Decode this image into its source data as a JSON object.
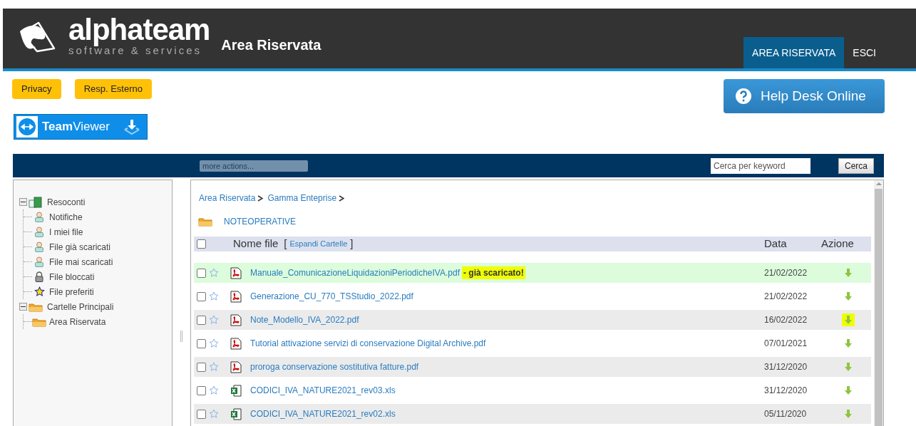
{
  "header": {
    "brand": "alphateam",
    "tagline": "software & services",
    "title": "Area Riservata",
    "nav": [
      {
        "label": "AREA RISERVATA",
        "selected": true
      },
      {
        "label": "ESCI",
        "selected": false
      }
    ]
  },
  "buttons": [
    "Privacy",
    "Resp. Esterno"
  ],
  "teamviewer": {
    "bold": "Team",
    "rest": "Viewer"
  },
  "helpdesk": "Help Desk Online",
  "toolbar": {
    "actions": "more actions...",
    "search_placeholder": "Cerca per keyword",
    "search_button": "Cerca"
  },
  "tree": [
    {
      "label": "Resoconti",
      "kind": "group",
      "expanded": true,
      "children": [
        {
          "label": "Notifiche",
          "kind": "person"
        },
        {
          "label": "I miei file",
          "kind": "person"
        },
        {
          "label": "File già scaricati",
          "kind": "person"
        },
        {
          "label": "File mai scaricati",
          "kind": "person"
        },
        {
          "label": "File bloccati",
          "kind": "lock"
        },
        {
          "label": "File preferiti",
          "kind": "star"
        }
      ]
    },
    {
      "label": "Cartelle Principali",
      "kind": "folder",
      "expanded": true,
      "children": [
        {
          "label": "Area Riservata",
          "kind": "folder"
        }
      ]
    }
  ],
  "breadcrumb": [
    "Area Riservata",
    "Gamma Enteprise"
  ],
  "folder": "NOTEOPERATIVE",
  "table": {
    "columns": [
      "Nome file",
      "Data",
      "Azione"
    ],
    "bracket_open": "[",
    "expand_link": "Espandi Cartelle",
    "bracket_close": "]",
    "checked_all": false,
    "rows": [
      {
        "name": "Manuale_ComunicazioneLiquidazioniPeriodicheIVA.pdf",
        "kind": "pdf",
        "date": "21/02/2022",
        "checked": false,
        "favorite": false,
        "downloaded": true,
        "note": "- già scaricato!",
        "action_highlighted": false
      },
      {
        "name": "Generazione_CU_770_TSStudio_2022.pdf",
        "kind": "pdf",
        "date": "21/02/2022",
        "checked": false,
        "favorite": false,
        "downloaded": false,
        "action_highlighted": false
      },
      {
        "name": "Note_Modello_IVA_2022.pdf",
        "kind": "pdf",
        "date": "16/02/2022",
        "checked": false,
        "favorite": false,
        "downloaded": false,
        "action_highlighted": true
      },
      {
        "name": "Tutorial attivazione servizi di conservazione Digital Archive.pdf",
        "kind": "pdf",
        "date": "07/01/2021",
        "checked": false,
        "favorite": false,
        "downloaded": false,
        "action_highlighted": false
      },
      {
        "name": "proroga conservazione sostitutiva fatture.pdf",
        "kind": "pdf",
        "date": "31/12/2020",
        "checked": false,
        "favorite": false,
        "downloaded": false,
        "action_highlighted": false
      },
      {
        "name": "CODICI_IVA_NATURE2021_rev03.xls",
        "kind": "xls",
        "date": "31/12/2020",
        "checked": false,
        "favorite": false,
        "downloaded": false,
        "action_highlighted": false
      },
      {
        "name": "CODICI_IVA_NATURE2021_rev02.xls",
        "kind": "xls",
        "date": "05/11/2020",
        "checked": false,
        "favorite": false,
        "downloaded": false,
        "action_highlighted": false
      }
    ]
  }
}
